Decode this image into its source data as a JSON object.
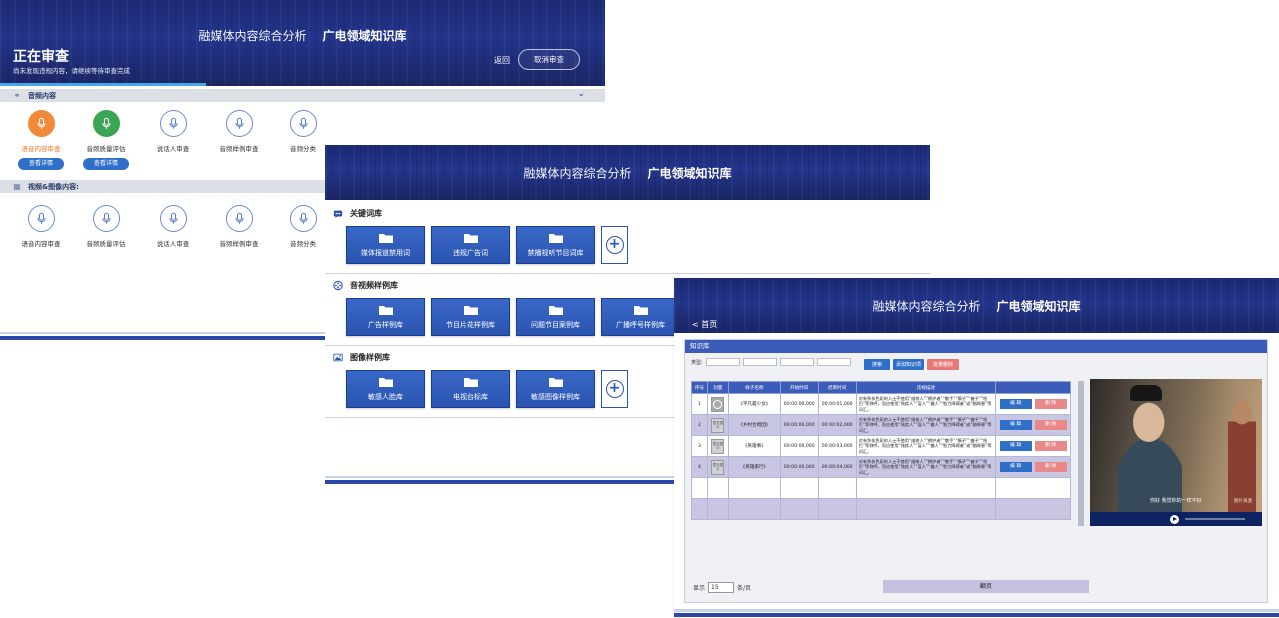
{
  "brand": {
    "title_main": "融媒体内容综合分析",
    "title_sub": "广电领域知识库"
  },
  "review_panel": {
    "heading": "正在审查",
    "subtext": "尚未发现违规内容，请继续等待审查完成",
    "back_label": "返回",
    "cancel_label": "取消审查",
    "progress": 0.34,
    "audio_section_title": "音频内容",
    "video_section_title": "视频&图像内容:",
    "detail_label": "查看详情",
    "audio_tools": [
      {
        "label": "语音内容审查",
        "icon": "microphone-icon",
        "state": "active"
      },
      {
        "label": "音频质量评估",
        "icon": "microphone-icon",
        "state": "done"
      },
      {
        "label": "说话人审查",
        "icon": "microphone-icon",
        "state": "idle"
      },
      {
        "label": "音频样例审查",
        "icon": "microphone-icon",
        "state": "idle"
      },
      {
        "label": "音频分类",
        "icon": "microphone-icon",
        "state": "idle"
      }
    ],
    "video_tools": [
      {
        "label": "语音内容审查",
        "icon": "microphone-icon"
      },
      {
        "label": "音频质量评估",
        "icon": "microphone-icon"
      },
      {
        "label": "说话人审查",
        "icon": "microphone-icon"
      },
      {
        "label": "音频样例审查",
        "icon": "microphone-icon"
      },
      {
        "label": "音频分类",
        "icon": "microphone-icon"
      }
    ]
  },
  "library_panel": {
    "sections": [
      {
        "title": "关键词库",
        "icon": "chat-icon",
        "cards": [
          "媒体报道禁用词",
          "违规广告词",
          "禁播视听节目词库"
        ]
      },
      {
        "title": "音视频样例库",
        "icon": "film-reel-icon",
        "cards": [
          "广告样例库",
          "节目片花样例库",
          "问题节目案例库",
          "广播呼号样例库"
        ]
      },
      {
        "title": "图像样例库",
        "icon": "image-icon",
        "cards": [
          "敏感人脸库",
          "电视台标库",
          "敏感图像样例库"
        ]
      }
    ]
  },
  "kb_panel": {
    "home_label": "< 首页",
    "box_title": "知识库",
    "filter_label": "类型:",
    "buttons": {
      "search": "搜索",
      "add": "添加知识项",
      "batch_delete": "批量删除"
    },
    "columns": [
      "序号",
      "封面",
      "样子名称",
      "开始时间",
      "结束时间",
      "违规描述",
      ""
    ],
    "rows": [
      {
        "no": "1",
        "thumb": "video",
        "name": "《平凡最少女》",
        "start": "00:00:00,000",
        "end": "00:00:01,000"
      },
      {
        "no": "2",
        "thumb": "暂无图片",
        "name": "《乡村合唱团》",
        "start": "00:00:00,000",
        "end": "00:00:02,000"
      },
      {
        "no": "3",
        "thumb": "暂无图片",
        "name": "《英雄事》",
        "start": "00:00:00,000",
        "end": "00:00:03,000"
      },
      {
        "no": "4",
        "thumb": "暂无图片",
        "name": "《英雄家行》",
        "start": "00:00:00,000",
        "end": "00:00:04,000"
      }
    ],
    "desc_text": "对有争执色彩的人士不使用“维修人”“拥护者”“敬手”“瘸子”“聋子”“哑巴”等称呼，而应使用“残疾人”“盲人”“聋人”“智力障碍者”或“脑障患”等词汇。",
    "edit_label": "编 辑",
    "delete_label": "删 除",
    "video_subtitle": "你好  我觉你的一样不好",
    "video_watermark": "图片来源",
    "page_prefix": "显示",
    "page_value": "15",
    "page_suffix": "条/页",
    "page_button": "翻页"
  }
}
